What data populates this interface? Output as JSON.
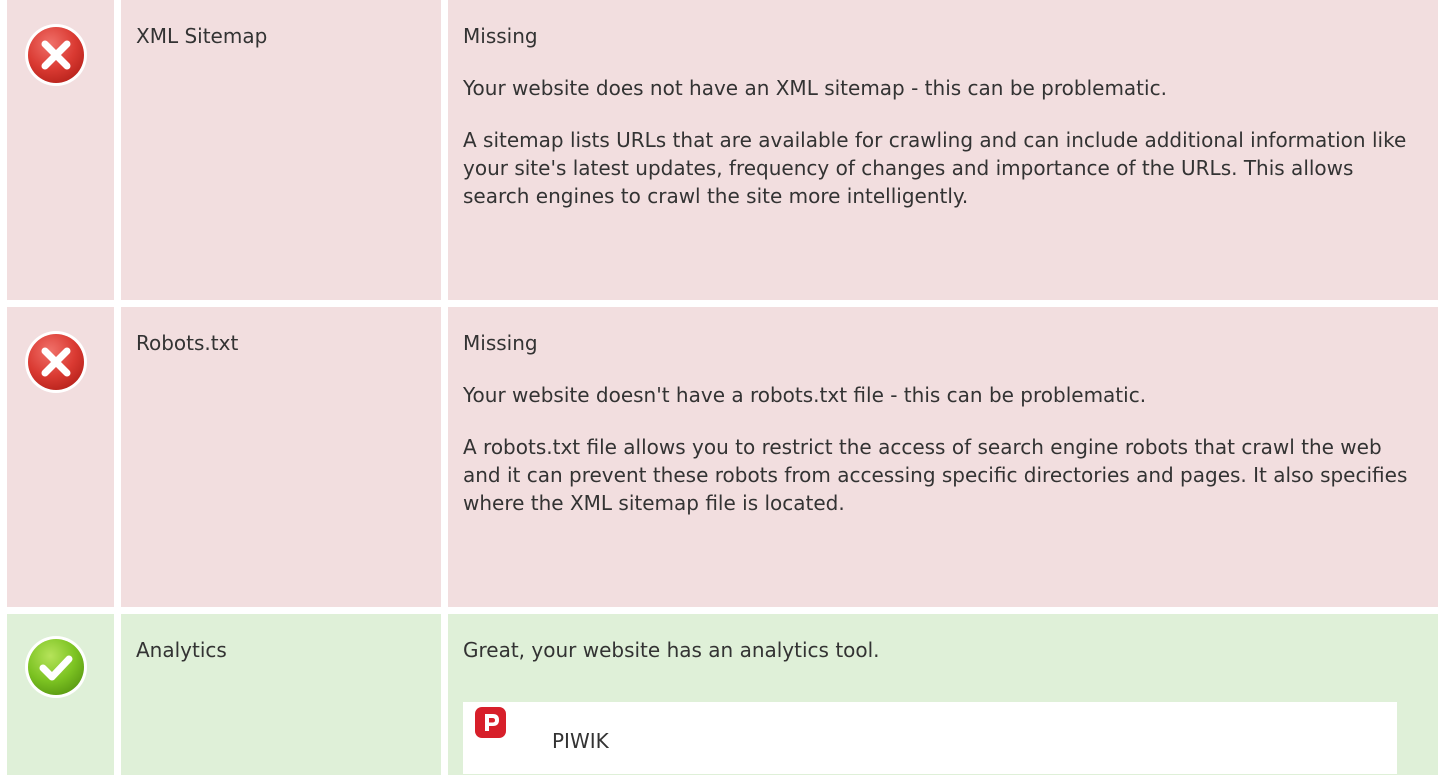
{
  "checks": [
    {
      "status": "error",
      "icon": "error-circle-icon",
      "name": "XML Sitemap",
      "result": "Missing",
      "summary": "Your website does not have an XML sitemap - this can be problematic.",
      "detail": "A sitemap lists URLs that are available for crawling and can include additional information like your site's latest updates, frequency of changes and importance of the URLs. This allows search engines to crawl the site more intelligently."
    },
    {
      "status": "error",
      "icon": "error-circle-icon",
      "name": "Robots.txt",
      "result": "Missing",
      "summary": "Your website doesn't have a robots.txt file - this can be problematic.",
      "detail": "A robots.txt file allows you to restrict the access of search engine robots that crawl the web and it can prevent these robots from accessing specific directories and pages. It also specifies where the XML sitemap file is located."
    },
    {
      "status": "success",
      "icon": "check-circle-icon",
      "name": "Analytics",
      "result": "Great, your website has an analytics tool.",
      "tool": {
        "icon": "piwik-logo-icon",
        "name": "PIWIK"
      }
    }
  ],
  "colors": {
    "error_bg": "#f2dedf",
    "success_bg": "#dff0d8",
    "error_icon": "#d9362f",
    "success_icon": "#7cc322",
    "piwik_logo": "#d71f2a",
    "text": "#333333"
  }
}
